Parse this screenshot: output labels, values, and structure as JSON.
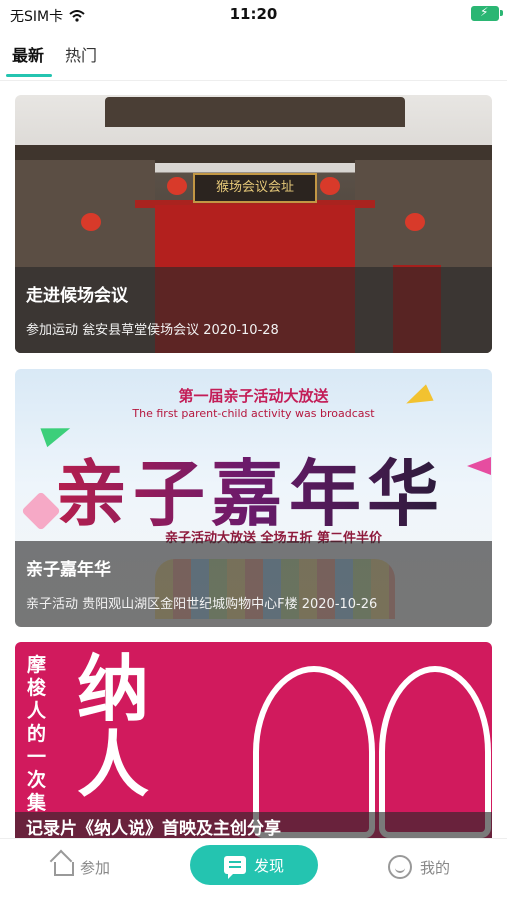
{
  "status_bar": {
    "carrier": "无SIM卡",
    "time": "11:20"
  },
  "tabs": [
    {
      "label": "最新",
      "active": true
    },
    {
      "label": "热门",
      "active": false
    }
  ],
  "cards": [
    {
      "title": "走进候场会议",
      "meta": "参加运动  瓮安县草堂侯场会议  2020-10-28",
      "image_sign": "猴场会议会址"
    },
    {
      "title": "亲子嘉年华",
      "meta": "亲子活动  贵阳观山湖区金阳世纪城购物中心F楼  2020-10-26",
      "poster": {
        "headline_cn": "第一届亲子活动大放送",
        "headline_en": "The first parent-child activity was broadcast",
        "big_text": "亲子嘉年华",
        "promo": "亲子活动大放送 全场五折 第二件半价"
      }
    },
    {
      "title": "记录片《纳人说》首映及主创分享",
      "poster": {
        "vertical_text": "摩梭人的一次集",
        "big_text_1": "纳",
        "big_text_2": "人"
      }
    }
  ],
  "bottom_nav": {
    "join": "参加",
    "discover": "发现",
    "mine": "我的",
    "accent": "#24c4b0"
  }
}
